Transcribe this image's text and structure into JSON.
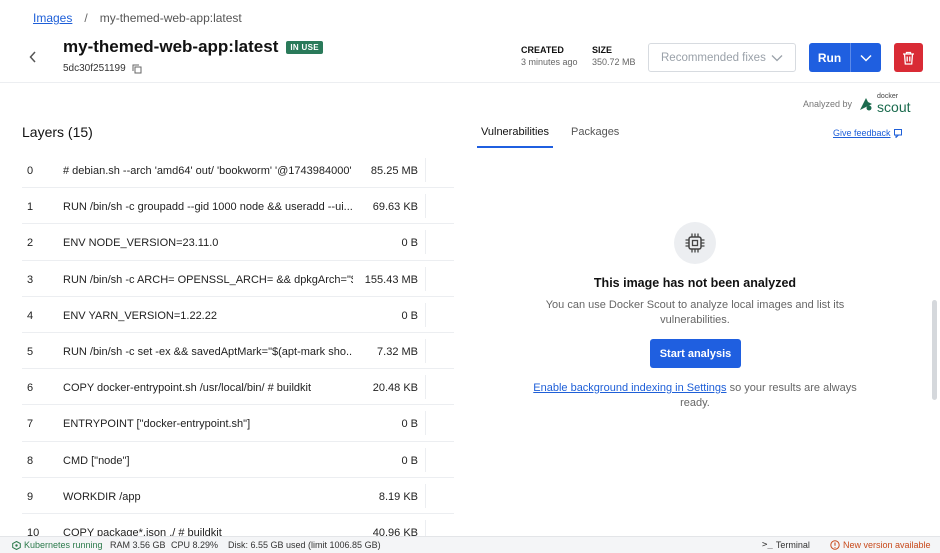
{
  "breadcrumb": {
    "root": "Images",
    "separator": "/",
    "current": "my-themed-web-app:latest"
  },
  "header": {
    "title": "my-themed-web-app:latest",
    "badge": "IN USE",
    "image_id": "5dc30f251199",
    "created_label": "CREATED",
    "created_value": "3 minutes ago",
    "size_label": "SIZE",
    "size_value": "350.72 MB",
    "recommended_fixes": "Recommended fixes",
    "run_label": "Run"
  },
  "analyzed_by": {
    "label": "Analyzed by",
    "brand_small": "docker",
    "brand_big": "scout"
  },
  "layers": {
    "title": "Layers (15)",
    "rows": [
      {
        "idx": "0",
        "cmd": "# debian.sh --arch 'amd64' out/ 'bookworm' '@1743984000'",
        "size": "85.25 MB"
      },
      {
        "idx": "1",
        "cmd": "RUN /bin/sh -c groupadd --gid 1000 node && useradd --ui...",
        "size": "69.63 KB"
      },
      {
        "idx": "2",
        "cmd": "ENV NODE_VERSION=23.11.0",
        "size": "0 B"
      },
      {
        "idx": "3",
        "cmd": "RUN /bin/sh -c ARCH= OPENSSL_ARCH= && dpkgArch=\"$...",
        "size": "155.43 MB"
      },
      {
        "idx": "4",
        "cmd": "ENV YARN_VERSION=1.22.22",
        "size": "0 B"
      },
      {
        "idx": "5",
        "cmd": "RUN /bin/sh -c set -ex && savedAptMark=\"$(apt-mark sho...",
        "size": "7.32 MB"
      },
      {
        "idx": "6",
        "cmd": "COPY docker-entrypoint.sh /usr/local/bin/ # buildkit",
        "size": "20.48 KB"
      },
      {
        "idx": "7",
        "cmd": "ENTRYPOINT [\"docker-entrypoint.sh\"]",
        "size": "0 B"
      },
      {
        "idx": "8",
        "cmd": "CMD [\"node\"]",
        "size": "0 B"
      },
      {
        "idx": "9",
        "cmd": "WORKDIR /app",
        "size": "8.19 KB"
      },
      {
        "idx": "10",
        "cmd": "COPY package*.json ./ # buildkit",
        "size": "40.96 KB"
      }
    ]
  },
  "tabs": {
    "vulnerabilities": "Vulnerabilities",
    "packages": "Packages"
  },
  "feedback": "Give feedback",
  "empty_state": {
    "title": "This image has not been analyzed",
    "description": "You can use Docker Scout to analyze local images and list its vulnerabilities.",
    "button": "Start analysis",
    "bg_link": "Enable background indexing in Settings",
    "bg_text": " so your results are always ready."
  },
  "statusbar": {
    "k8s": "Kubernetes running",
    "ram": "RAM 3.56 GB",
    "cpu": "CPU 8.29%",
    "disk": "Disk: 6.55 GB used (limit 1006.85 GB)",
    "terminal": "Terminal",
    "new_version": "New version available"
  },
  "colors": {
    "accent": "#1f5fe0",
    "danger": "#d92b35",
    "badge": "#2a7a5a",
    "scout": "#1b6b4e"
  }
}
